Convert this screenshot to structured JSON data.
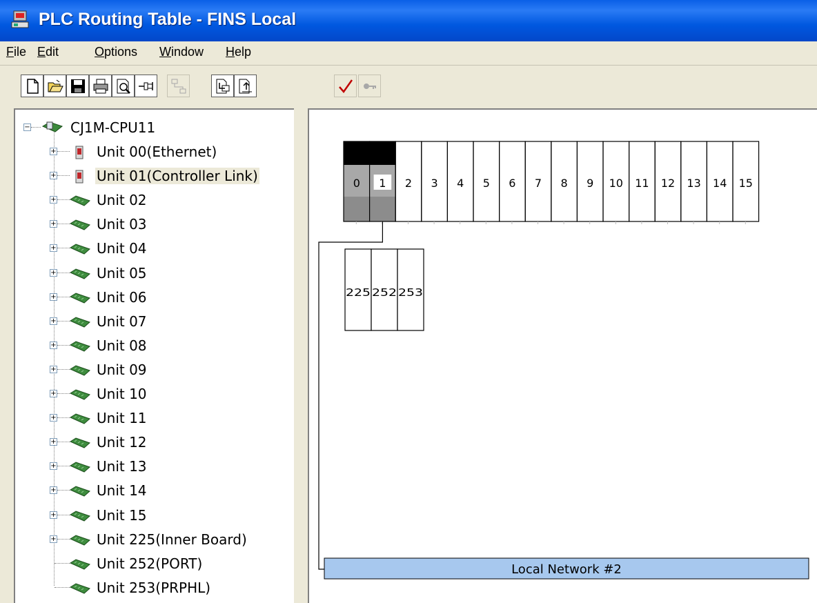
{
  "window": {
    "title": "PLC Routing Table - FINS Local"
  },
  "menu": [
    {
      "label": "File",
      "u": "F"
    },
    {
      "label": "Edit",
      "u": "E"
    },
    {
      "label": "Options",
      "u": "O"
    },
    {
      "label": "Window",
      "u": "W"
    },
    {
      "label": "Help",
      "u": "H"
    }
  ],
  "toolbar": {
    "buttons": [
      {
        "name": "new-icon",
        "enabled": true
      },
      {
        "name": "open-folder-icon",
        "enabled": true
      },
      {
        "name": "save-icon",
        "enabled": true
      },
      {
        "name": "print-icon",
        "enabled": true
      },
      {
        "name": "print-preview-icon",
        "enabled": true
      },
      {
        "name": "pin-icon",
        "enabled": true
      },
      {
        "name": "network-routing-icon",
        "enabled": false
      },
      {
        "name": "transfer-from-plc-icon",
        "enabled": true
      },
      {
        "name": "transfer-to-plc-icon",
        "enabled": true
      },
      {
        "name": "check-icon",
        "enabled": true
      },
      {
        "name": "key-icon",
        "enabled": false
      }
    ]
  },
  "tree": {
    "root": "CJ1M-CPU11",
    "items": [
      {
        "label": "Unit 00(Ethernet)",
        "icon": "unit-card-icon",
        "expandable": true
      },
      {
        "label": "Unit 01(Controller Link)",
        "icon": "unit-card-icon",
        "expandable": true,
        "selected": true
      },
      {
        "label": "Unit 02",
        "icon": "unit-board-icon",
        "expandable": true
      },
      {
        "label": "Unit 03",
        "icon": "unit-board-icon",
        "expandable": true
      },
      {
        "label": "Unit 04",
        "icon": "unit-board-icon",
        "expandable": true
      },
      {
        "label": "Unit 05",
        "icon": "unit-board-icon",
        "expandable": true
      },
      {
        "label": "Unit 06",
        "icon": "unit-board-icon",
        "expandable": true
      },
      {
        "label": "Unit 07",
        "icon": "unit-board-icon",
        "expandable": true
      },
      {
        "label": "Unit 08",
        "icon": "unit-board-icon",
        "expandable": true
      },
      {
        "label": "Unit 09",
        "icon": "unit-board-icon",
        "expandable": true
      },
      {
        "label": "Unit 10",
        "icon": "unit-board-icon",
        "expandable": true
      },
      {
        "label": "Unit 11",
        "icon": "unit-board-icon",
        "expandable": true
      },
      {
        "label": "Unit 12",
        "icon": "unit-board-icon",
        "expandable": true
      },
      {
        "label": "Unit 13",
        "icon": "unit-board-icon",
        "expandable": true
      },
      {
        "label": "Unit 14",
        "icon": "unit-board-icon",
        "expandable": true
      },
      {
        "label": "Unit 15",
        "icon": "unit-board-icon",
        "expandable": true
      },
      {
        "label": "Unit 225(Inner Board)",
        "icon": "unit-board-icon",
        "expandable": true
      },
      {
        "label": "Unit 252(PORT)",
        "icon": "unit-board-icon",
        "expandable": false
      },
      {
        "label": "Unit 253(PRPHL)",
        "icon": "unit-board-icon",
        "expandable": false
      }
    ]
  },
  "diagram": {
    "slots": [
      "0",
      "1",
      "2",
      "3",
      "4",
      "5",
      "6",
      "7",
      "8",
      "9",
      "10",
      "11",
      "12",
      "13",
      "14",
      "15"
    ],
    "occupied_slots": [
      "0",
      "1"
    ],
    "selected_slot": "1",
    "inner_slots": [
      "225",
      "252",
      "253"
    ],
    "network_label": "Local Network #2"
  }
}
